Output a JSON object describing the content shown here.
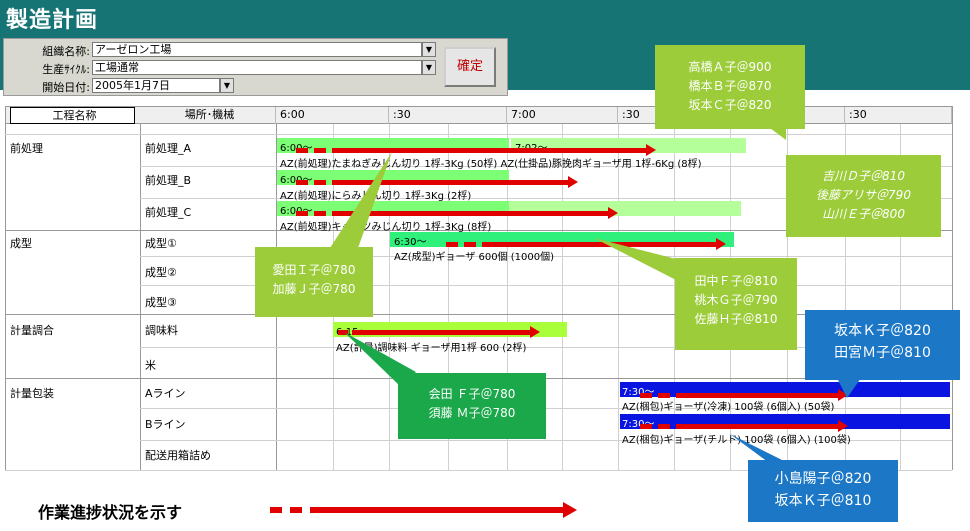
{
  "app": {
    "title": "製造計画"
  },
  "form": {
    "org_label": "組織名称:",
    "org_value": "アーゼロン工場",
    "cycle_label": "生産ｻｲｸﾙ:",
    "cycle_value": "工場通常",
    "date_label": "開始日付:",
    "date_value": "2005年1月7日",
    "confirm_label": "確定"
  },
  "grid": {
    "col_process": "工程名称",
    "col_location": "場所･機械",
    "times": [
      "6:00",
      ":30",
      "7:00",
      ":30",
      "8:00",
      ":30"
    ]
  },
  "rows": {
    "pre": "前処理",
    "pre_a": "前処理_A",
    "pre_b": "前処理_B",
    "pre_c": "前処理_C",
    "form": "成型",
    "form1": "成型①",
    "form2": "成型②",
    "form3": "成型③",
    "mix": "計量調合",
    "seasoning": "調味料",
    "rice": "米",
    "pack": "計量包装",
    "line_a": "Aライン",
    "line_b": "Bライン",
    "ship": "配送用箱詰め"
  },
  "bars": {
    "a1_time": "6:00～",
    "a2_time": "7:02～",
    "a_text": "AZ(前処理)たまねぎみじん切り 1桴-3Kg (50桴)  AZ(仕掛品)豚挽肉ギョーザ用 1桴-6Kg (8桴)",
    "b_time": "6:00～",
    "b_text": "AZ(前処理)にらみじん切り 1桴-3Kg (2桴)",
    "c_time": "6:00～",
    "c_text": "AZ(前処理)キャベツみじん切り 1桴-3Kg (8桴)",
    "f_time": "6:30～",
    "f_text": "AZ(成型)ギョーザ  600個 (1000個)",
    "m_time": "6:15～",
    "m_text": "AZ(計量)調味料 ギョーザ用1桴 600 (2桴)",
    "la_time": "7:30～",
    "la_text": "AZ(梱包)ギョーザ(冷凍) 100袋 (6個入) (50袋)",
    "lb_time": "7:30～",
    "lb_text": "AZ(梱包)ギョーザ(チルド) 100袋 (6個入) (100袋)"
  },
  "callouts": {
    "c1": [
      "高橋Ａ子＠900",
      "橋本Ｂ子＠870",
      "坂本Ｃ子＠820"
    ],
    "c2": [
      "吉川Ｄ子＠810",
      "後藤アリサ＠790",
      "山川Ｅ子＠800"
    ],
    "c3": [
      "愛田Ｉ子＠780",
      "加藤Ｊ子＠780"
    ],
    "c4": [
      "田中Ｆ子＠810",
      "桃木Ｇ子＠790",
      "佐藤Ｈ子＠810"
    ],
    "c5": [
      "坂本Ｋ子＠820",
      "田宮Ｍ子＠810"
    ],
    "c6": [
      "会田 Ｆ子＠780",
      "須藤 Ｍ子＠780"
    ],
    "c7": [
      "小島陽子＠820",
      "坂本Ｋ子＠810"
    ]
  },
  "legend": {
    "text": "作業進捗状況を示す"
  },
  "colors": {
    "header": "#177474",
    "bar_green": "#7cff74",
    "bar_blue": "#0a14e0",
    "progress": "#e00000"
  }
}
